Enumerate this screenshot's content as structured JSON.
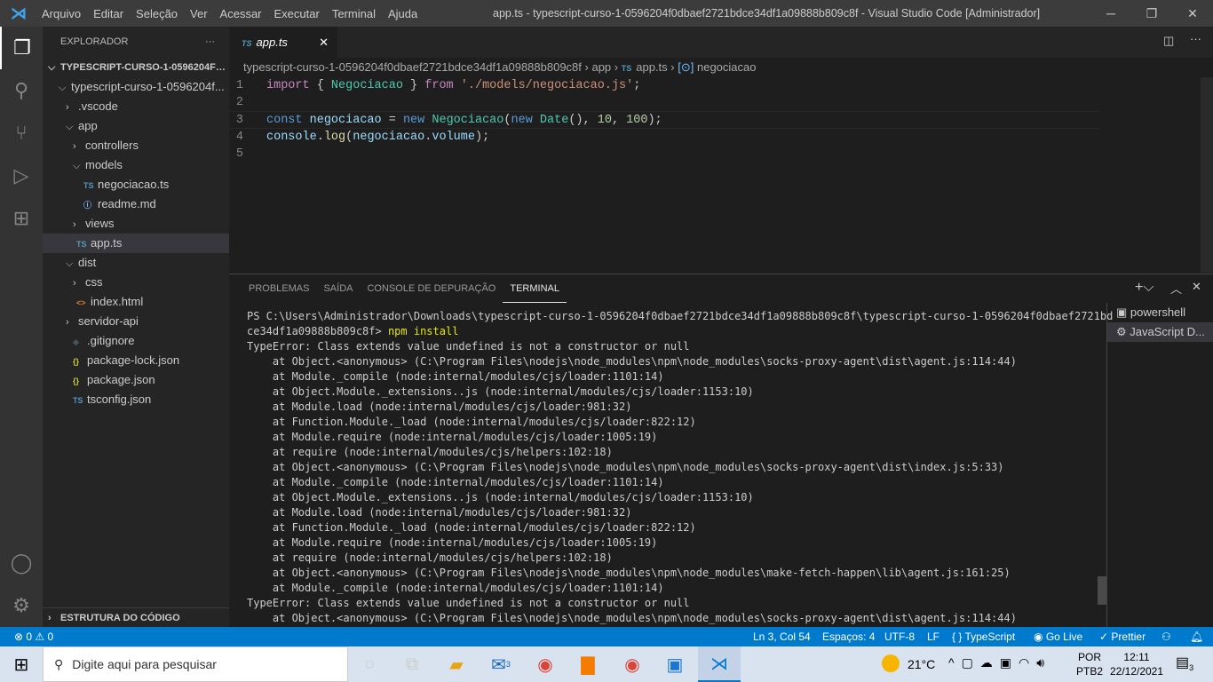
{
  "titlebar": {
    "menus": [
      "Arquivo",
      "Editar",
      "Seleção",
      "Ver",
      "Acessar",
      "Executar",
      "Terminal",
      "Ajuda"
    ],
    "title": "app.ts - typescript-curso-1-0596204f0dbaef2721bdce34df1a09888b809c8f - Visual Studio Code [Administrador]"
  },
  "sidebar": {
    "header": "EXPLORADOR",
    "more": "···",
    "root": "TYPESCRIPT-CURSO-1-0596204F0...",
    "outline": "ESTRUTURA DO CÓDIGO",
    "items": [
      {
        "label": "typescript-curso-1-0596204f...",
        "indent": 1,
        "type": "folder-open"
      },
      {
        "label": ".vscode",
        "indent": 2,
        "type": "folder"
      },
      {
        "label": "app",
        "indent": 2,
        "type": "folder-open"
      },
      {
        "label": "controllers",
        "indent": 3,
        "type": "folder"
      },
      {
        "label": "models",
        "indent": 3,
        "type": "folder-open"
      },
      {
        "label": "negociacao.ts",
        "indent": 4,
        "type": "ts"
      },
      {
        "label": "readme.md",
        "indent": 4,
        "type": "info"
      },
      {
        "label": "views",
        "indent": 3,
        "type": "folder"
      },
      {
        "label": "app.ts",
        "indent": 3,
        "type": "ts",
        "selected": true
      },
      {
        "label": "dist",
        "indent": 2,
        "type": "folder-open"
      },
      {
        "label": "css",
        "indent": 3,
        "type": "folder"
      },
      {
        "label": "index.html",
        "indent": 3,
        "type": "html"
      },
      {
        "label": "servidor-api",
        "indent": 2,
        "type": "folder"
      },
      {
        "label": ".gitignore",
        "indent": 2,
        "type": "git"
      },
      {
        "label": "package-lock.json",
        "indent": 2,
        "type": "json"
      },
      {
        "label": "package.json",
        "indent": 2,
        "type": "json"
      },
      {
        "label": "tsconfig.json",
        "indent": 2,
        "type": "tsconfig"
      }
    ]
  },
  "editor": {
    "tab": "app.ts",
    "tab_badge": "TS",
    "breadcrumb": [
      "typescript-curso-1-0596204f0dbaef2721bdce34df1a09888b809c8f",
      "app",
      "app.ts",
      "negociacao"
    ],
    "lines": [
      "import { Negociacao } from './models/negociacao.js';",
      "",
      "const negociacao = new Negociacao(new Date(), 10, 100);",
      "console.log(negociacao.volume);",
      ""
    ]
  },
  "panel": {
    "tabs": [
      "PROBLEMAS",
      "SAÍDA",
      "CONSOLE DE DEPURAÇÃO",
      "TERMINAL"
    ],
    "active": "TERMINAL",
    "terminals": [
      "powershell",
      "JavaScript D..."
    ],
    "prompt": "PS C:\\Users\\Administrador\\Downloads\\typescript-curso-1-0596204f0dbaef2721bdce34df1a09888b809c8f\\typescript-curso-1-0596204f0dbaef2721bd",
    "prompt2": "ce34df1a09888b809c8f> ",
    "command": "npm install",
    "output": [
      "TypeError: Class extends value undefined is not a constructor or null",
      "    at Object.<anonymous> (C:\\Program Files\\nodejs\\node_modules\\npm\\node_modules\\socks-proxy-agent\\dist\\agent.js:114:44)",
      "    at Module._compile (node:internal/modules/cjs/loader:1101:14)",
      "    at Object.Module._extensions..js (node:internal/modules/cjs/loader:1153:10)",
      "    at Module.load (node:internal/modules/cjs/loader:981:32)",
      "    at Function.Module._load (node:internal/modules/cjs/loader:822:12)",
      "    at Module.require (node:internal/modules/cjs/loader:1005:19)",
      "    at require (node:internal/modules/cjs/helpers:102:18)",
      "    at Object.<anonymous> (C:\\Program Files\\nodejs\\node_modules\\npm\\node_modules\\socks-proxy-agent\\dist\\index.js:5:33)",
      "    at Module._compile (node:internal/modules/cjs/loader:1101:14)",
      "    at Object.Module._extensions..js (node:internal/modules/cjs/loader:1153:10)",
      "    at Module.load (node:internal/modules/cjs/loader:981:32)",
      "    at Function.Module._load (node:internal/modules/cjs/loader:822:12)",
      "    at Module.require (node:internal/modules/cjs/loader:1005:19)",
      "    at require (node:internal/modules/cjs/helpers:102:18)",
      "    at Object.<anonymous> (C:\\Program Files\\nodejs\\node_modules\\npm\\node_modules\\make-fetch-happen\\lib\\agent.js:161:25)",
      "    at Module._compile (node:internal/modules/cjs/loader:1101:14)",
      "TypeError: Class extends value undefined is not a constructor or null",
      "    at Object.<anonymous> (C:\\Program Files\\nodejs\\node_modules\\npm\\node_modules\\socks-proxy-agent\\dist\\agent.js:114:44)"
    ]
  },
  "status": {
    "errors": "0",
    "warnings": "0",
    "position": "Ln 3, Col 54",
    "spaces": "Espaços: 4",
    "encoding": "UTF-8",
    "eol": "LF",
    "language": "TypeScript",
    "golive": "Go Live",
    "prettier": "Prettier"
  },
  "taskbar": {
    "search_placeholder": "Digite aqui para pesquisar",
    "temp": "21°C",
    "lang1": "POR",
    "lang2": "PTB2",
    "time": "12:11",
    "date": "22/12/2021",
    "notifications": "3",
    "mail_badge": "3"
  },
  "colors": {
    "accent": "#007acc",
    "titlebar": "#3c3c3c",
    "sidebar": "#252526",
    "editor": "#1e1e1e"
  }
}
